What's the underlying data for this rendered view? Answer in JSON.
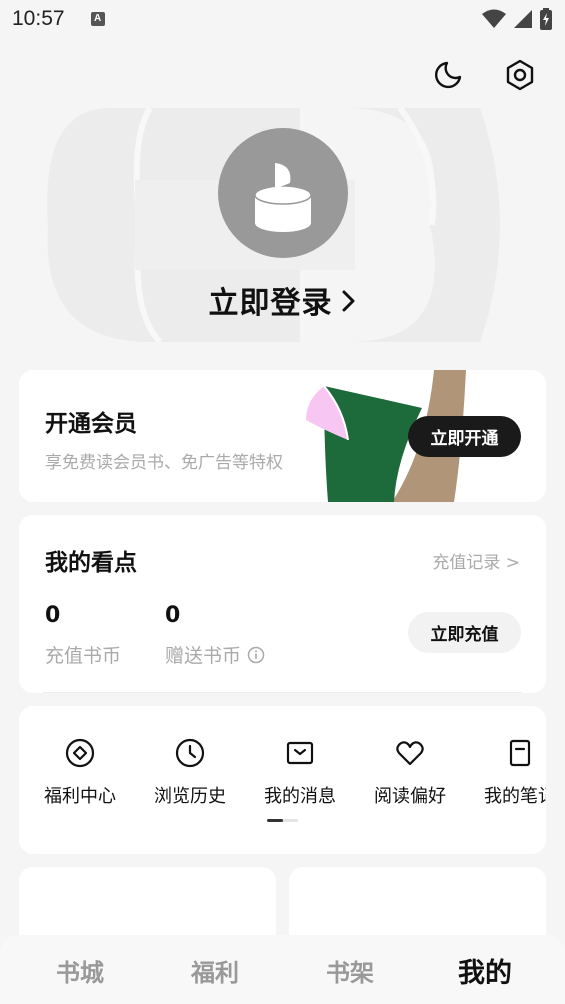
{
  "status_bar": {
    "time": "10:57",
    "notification_icon": "A"
  },
  "header": {
    "theme_icon": "moon-icon",
    "settings_icon": "settings-hex-icon"
  },
  "profile": {
    "login_label": "立即登录"
  },
  "vip": {
    "title": "开通会员",
    "subtitle": "享免费读会员书、免广告等特权",
    "button_label": "立即开通",
    "colors": {
      "pink": "#f7c6f3",
      "green": "#1d6b3a",
      "tan": "#b19578"
    }
  },
  "points": {
    "title": "我的看点",
    "record_link": "充值记录 >",
    "recharge_coins": {
      "value": "0",
      "label": "充值书币"
    },
    "gift_coins": {
      "value": "0",
      "label": "赠送书币"
    },
    "button_label": "立即充值"
  },
  "menu": {
    "items": [
      {
        "label": "福利中心",
        "icon": "gift-diamond-icon"
      },
      {
        "label": "浏览历史",
        "icon": "clock-icon"
      },
      {
        "label": "我的消息",
        "icon": "message-icon"
      },
      {
        "label": "阅读偏好",
        "icon": "heart-icon"
      },
      {
        "label": "我的笔记",
        "icon": "note-icon"
      }
    ]
  },
  "bottom_nav": {
    "items": [
      {
        "label": "书城"
      },
      {
        "label": "福利"
      },
      {
        "label": "书架"
      },
      {
        "label": "我的"
      }
    ],
    "active_index": 3
  }
}
